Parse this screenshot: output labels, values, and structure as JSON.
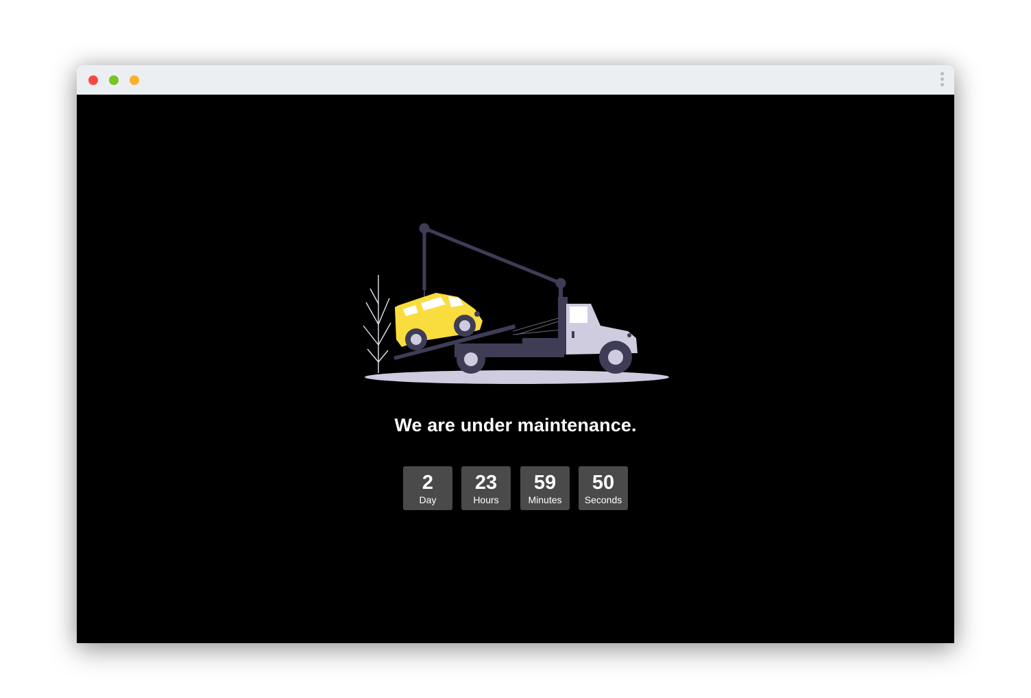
{
  "window": {
    "controls": [
      "close",
      "minimize",
      "maximize"
    ],
    "menu_icon": "kebab-menu-icon"
  },
  "illustration": {
    "subject": "tow-truck-lifting-car",
    "colors": {
      "car": "#f9dc3e",
      "truck_dark": "#3f3d56",
      "truck_light": "#cfcce0",
      "ground": "#cfcce0"
    }
  },
  "main": {
    "headline": "We are under maintenance."
  },
  "countdown": [
    {
      "value": "2",
      "label": "Day"
    },
    {
      "value": "23",
      "label": "Hours"
    },
    {
      "value": "59",
      "label": "Minutes"
    },
    {
      "value": "50",
      "label": "Seconds"
    }
  ],
  "colors": {
    "background": "#000000",
    "titlebar": "#eceff1",
    "countdown_box": "#4a4a4a",
    "text": "#ffffff"
  }
}
